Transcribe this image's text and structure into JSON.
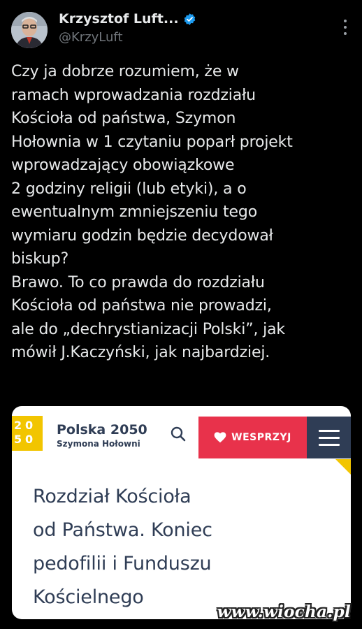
{
  "author": {
    "name": "Krzysztof Luft...",
    "handle": "@KrzyLuft",
    "verified": true
  },
  "tweet": {
    "text": "Czy ja dobrze rozumiem, że w\nramach wprowadzania rozdziału\nKościoła od państwa, Szymon\nHołownia w 1 czytaniu poparł projekt\nwprowadzający obowiązkowe\n2 godziny religii (lub etyki), a o\newentualnym zmniejszeniu tego\nwymiaru godzin będzie decydował\nbiskup?\nBrawo. To co prawda do rozdziału\nKościoła od państwa nie prowadzi,\nale do „dechrystianizacji Polski”, jak\nmówił J.Kaczyński, jak najbardziej."
  },
  "card": {
    "logo_glyphs": [
      "2",
      "0",
      "5",
      "0"
    ],
    "brand_name": "Polska 2050",
    "brand_sub": "Szymona Hołowni",
    "donate_label": "WESPRZYJ",
    "headline": "Rozdział Kościoła\nod Państwa. Koniec\npedofilii i Funduszu\nKościelnego"
  },
  "watermark": "www.wiocha.pl",
  "icons": {
    "verified": "verified-badge-icon",
    "more": "more-options-icon",
    "search": "search-icon",
    "heart": "heart-icon",
    "menu": "hamburger-menu-icon"
  },
  "colors": {
    "background": "#000000",
    "text": "#e7e9ea",
    "handle": "#71767b",
    "verified": "#1d9bf0",
    "brand_navy": "#2f3d55",
    "brand_yellow": "#f2c500",
    "donate_red": "#e8324b"
  }
}
